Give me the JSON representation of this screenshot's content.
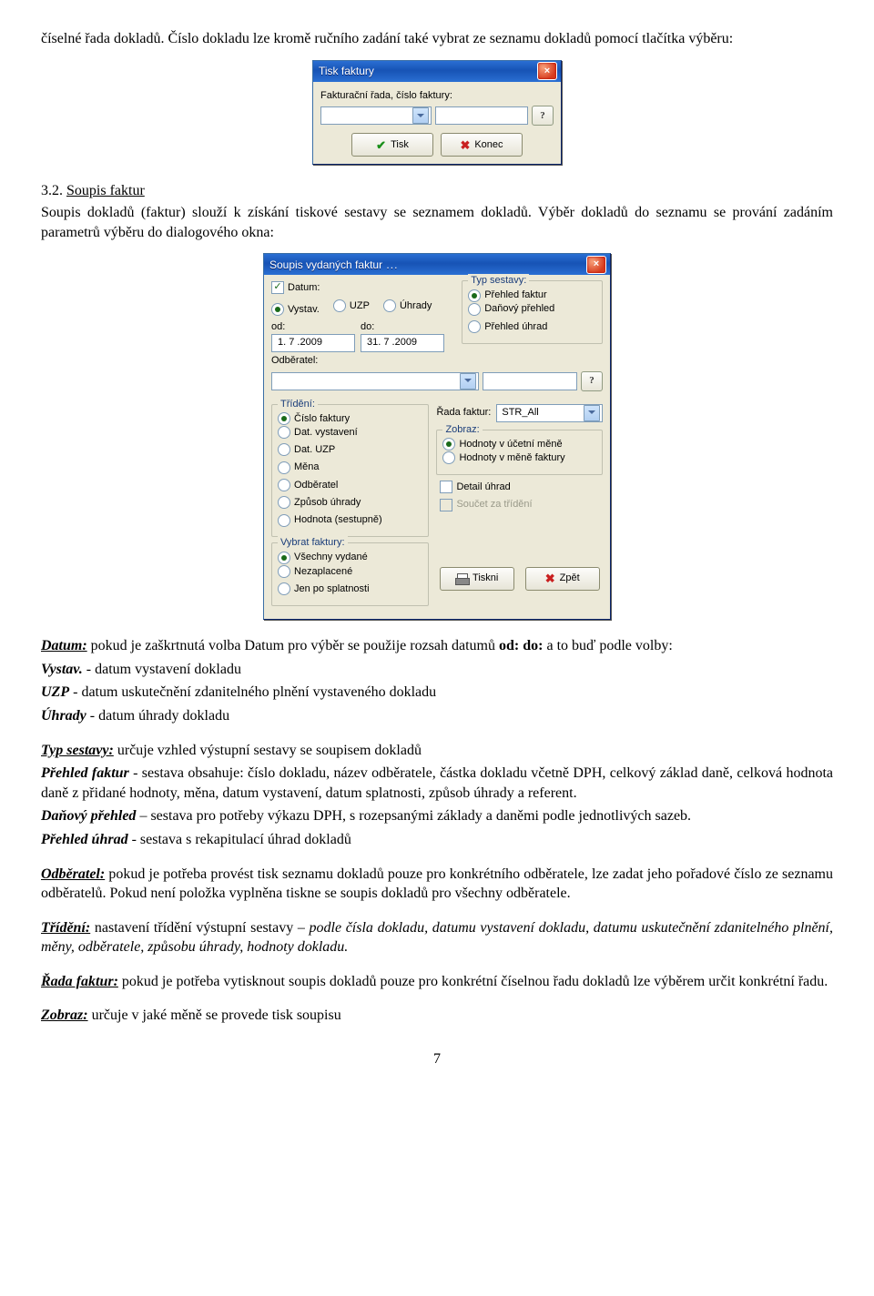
{
  "intro": "číselné řada dokladů. Číslo dokladu lze kromě ručního zadání také vybrat ze seznamu dokladů pomocí tlačítka výběru:",
  "dlg1": {
    "title": "Tisk faktury",
    "label": "Fakturační řada,  číslo faktury:",
    "q": "?",
    "btn_tisk": "Tisk",
    "btn_konec": "Konec"
  },
  "section": {
    "no": "3.2.",
    "name": "Soupis faktur"
  },
  "section_intro": "Soupis dokladů (faktur) slouží k získání tiskové sestavy se seznamem dokladů. Výběr dokladů do seznamu se prování zadáním parametrů výběru do dialogového okna:",
  "dlg2": {
    "title": "Soupis vydaných faktur",
    "datum": "Datum:",
    "vystav": "Vystav.",
    "uzp": "UZP",
    "uhrady": "Úhrady",
    "od": "od:",
    "do": "do:",
    "od_val": "1. 7 .2009",
    "do_val": "31. 7 .2009",
    "sestava": "Typ sestavy:",
    "s1": "Přehled faktur",
    "s2": "Daňový přehled",
    "s3": "Přehled úhrad",
    "odberatel": "Odběratel:",
    "q": "?",
    "trideni": "Třídění:",
    "t1": "Číslo faktury",
    "t2": "Dat. vystavení",
    "t3": "Dat. UZP",
    "t4": "Měna",
    "t5": "Odběratel",
    "t6": "Způsob úhrady",
    "t7": "Hodnota (sestupně)",
    "rada": "Řada faktur:",
    "rada_val": "STR_All",
    "zobraz": "Zobraz:",
    "z1": "Hodnoty v účetní měně",
    "z2": "Hodnoty v měně faktury",
    "detail": "Detail úhrad",
    "soucet": "Součet za třídění",
    "vybrat": "Vybrat faktury:",
    "v1": "Všechny vydané",
    "v2": "Nezaplacené",
    "v3": "Jen po splatnosti",
    "btn_tiskni": "Tiskni",
    "btn_zpet": "Zpět"
  },
  "para_datum": {
    "lead": "Datum:",
    "text": " pokud je zaškrtnutá volba Datum pro výběr se použije rozsah datumů ",
    "od": "od:",
    "do": "do:",
    "rest": " a to buď podle volby:"
  },
  "ln_vystav_label": "Vystav.",
  "ln_vystav_text": "  - datum vystavení dokladu",
  "ln_uzp_label": "UZP",
  "ln_uzp_text": "       - datum uskutečnění zdanitelného plnění vystaveného dokladu",
  "ln_uhr_label": "Úhrady",
  "ln_uhr_text": "  - datum úhrady dokladu",
  "typ_sestavy": "Typ sestavy:",
  "typ_sestavy_text": " určuje vzhled výstupní sestavy se soupisem dokladů",
  "pf_label": "Přehled faktur",
  "pf_text": "  - sestava obsahuje: číslo dokladu, název odběratele, částka dokladu včetně DPH, celkový základ daně, celková hodnota daně z přidané hodnoty, měna, datum vystavení, datum splatnosti, způsob úhrady a referent.",
  "dp_label": "Daňový přehled",
  "dp_text": " – sestava pro potřeby výkazu DPH, s rozepsanými základy a daněmi podle jednotlivých sazeb.",
  "pu_label": "Přehled úhrad",
  "pu_text": "  - sestava s rekapitulací úhrad dokladů",
  "odb_label": "Odběratel:",
  "odb_text": " pokud je potřeba provést tisk seznamu dokladů pouze pro konkrétního odběratele, lze zadat jeho pořadové číslo ze seznamu odběratelů. Pokud není položka vyplněna tiskne se soupis dokladů pro všechny odběratele.",
  "tr_label": "Třídění:",
  "tr_text1": " nastavení třídění výstupní sestavy – ",
  "tr_text2": "podle čísla dokladu, datumu vystavení dokladu, datumu uskutečnění zdanitelného plnění, měny, odběratele, způsobu úhrady, hodnoty dokladu.",
  "rada_label": "Řada faktur:",
  "rada_text": " pokud je potřeba vytisknout soupis dokladů pouze pro konkrétní číselnou řadu dokladů lze výběrem určit konkrétní řadu.",
  "zob_label": "Zobraz:",
  "zob_text": " určuje v jaké měně se provede tisk soupisu",
  "page": "7"
}
